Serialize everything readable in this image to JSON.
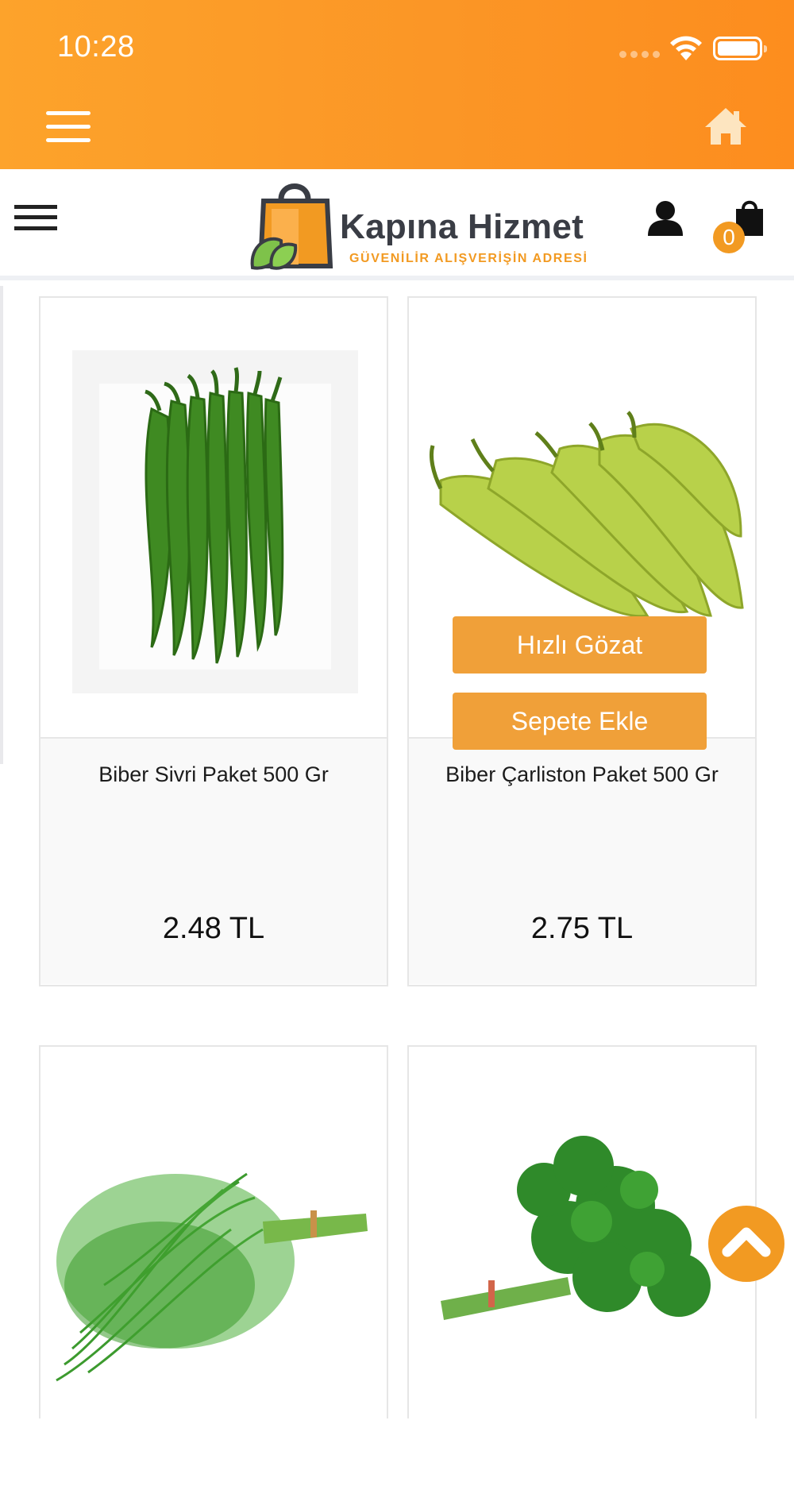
{
  "status_bar": {
    "time": "10:28"
  },
  "brand": {
    "name": "Kapına Hizmet",
    "tagline": "GÜVENİLİR ALIŞVERİŞİN ADRESİ",
    "accent_color": "#f29a22",
    "appbar_color": "#fb9626"
  },
  "header": {
    "cart_count": "0"
  },
  "products": [
    {
      "name": "Biber Sivri Paket 500 Gr",
      "price": "2.48 TL"
    },
    {
      "name": "Biber Çarliston Paket 500 Gr",
      "price": "2.75 TL"
    },
    {
      "name": "",
      "price": ""
    },
    {
      "name": "",
      "price": ""
    }
  ],
  "quick_actions": {
    "quick_view": "Hızlı Gözat",
    "add_to_cart": "Sepete Ekle"
  },
  "icons": {
    "app_menu": "hamburger-icon",
    "home": "home-icon",
    "site_menu": "hamburger-icon",
    "user": "user-icon",
    "cart": "shopping-bag-icon",
    "scroll_top": "chevron-up-icon"
  }
}
